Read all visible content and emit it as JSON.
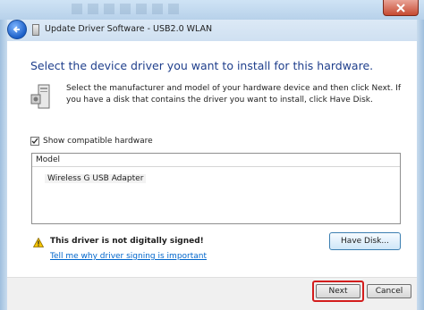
{
  "window": {
    "title": "Update Driver Software - USB2.0 WLAN",
    "close_icon": "close-icon",
    "back_icon": "back-arrow-icon"
  },
  "content": {
    "heading": "Select the device driver you want to install for this hardware.",
    "instructions": "Select the manufacturer and model of your hardware device and then click Next. If you have a disk that contains the driver you want to install, click Have Disk.",
    "show_compatible_label": "Show compatible hardware",
    "show_compatible_checked": true,
    "model_list": {
      "column_header": "Model",
      "items": [
        "Wireless G USB Adapter"
      ]
    },
    "warning_text": "This driver is not digitally signed!",
    "have_disk_label": "Have Disk...",
    "signing_link": "Tell me why driver signing is important"
  },
  "footer": {
    "next_label": "Next",
    "cancel_label": "Cancel"
  },
  "colors": {
    "heading": "#1f3f8c",
    "link": "#0066cc",
    "highlight_ring": "#d31d1d"
  }
}
